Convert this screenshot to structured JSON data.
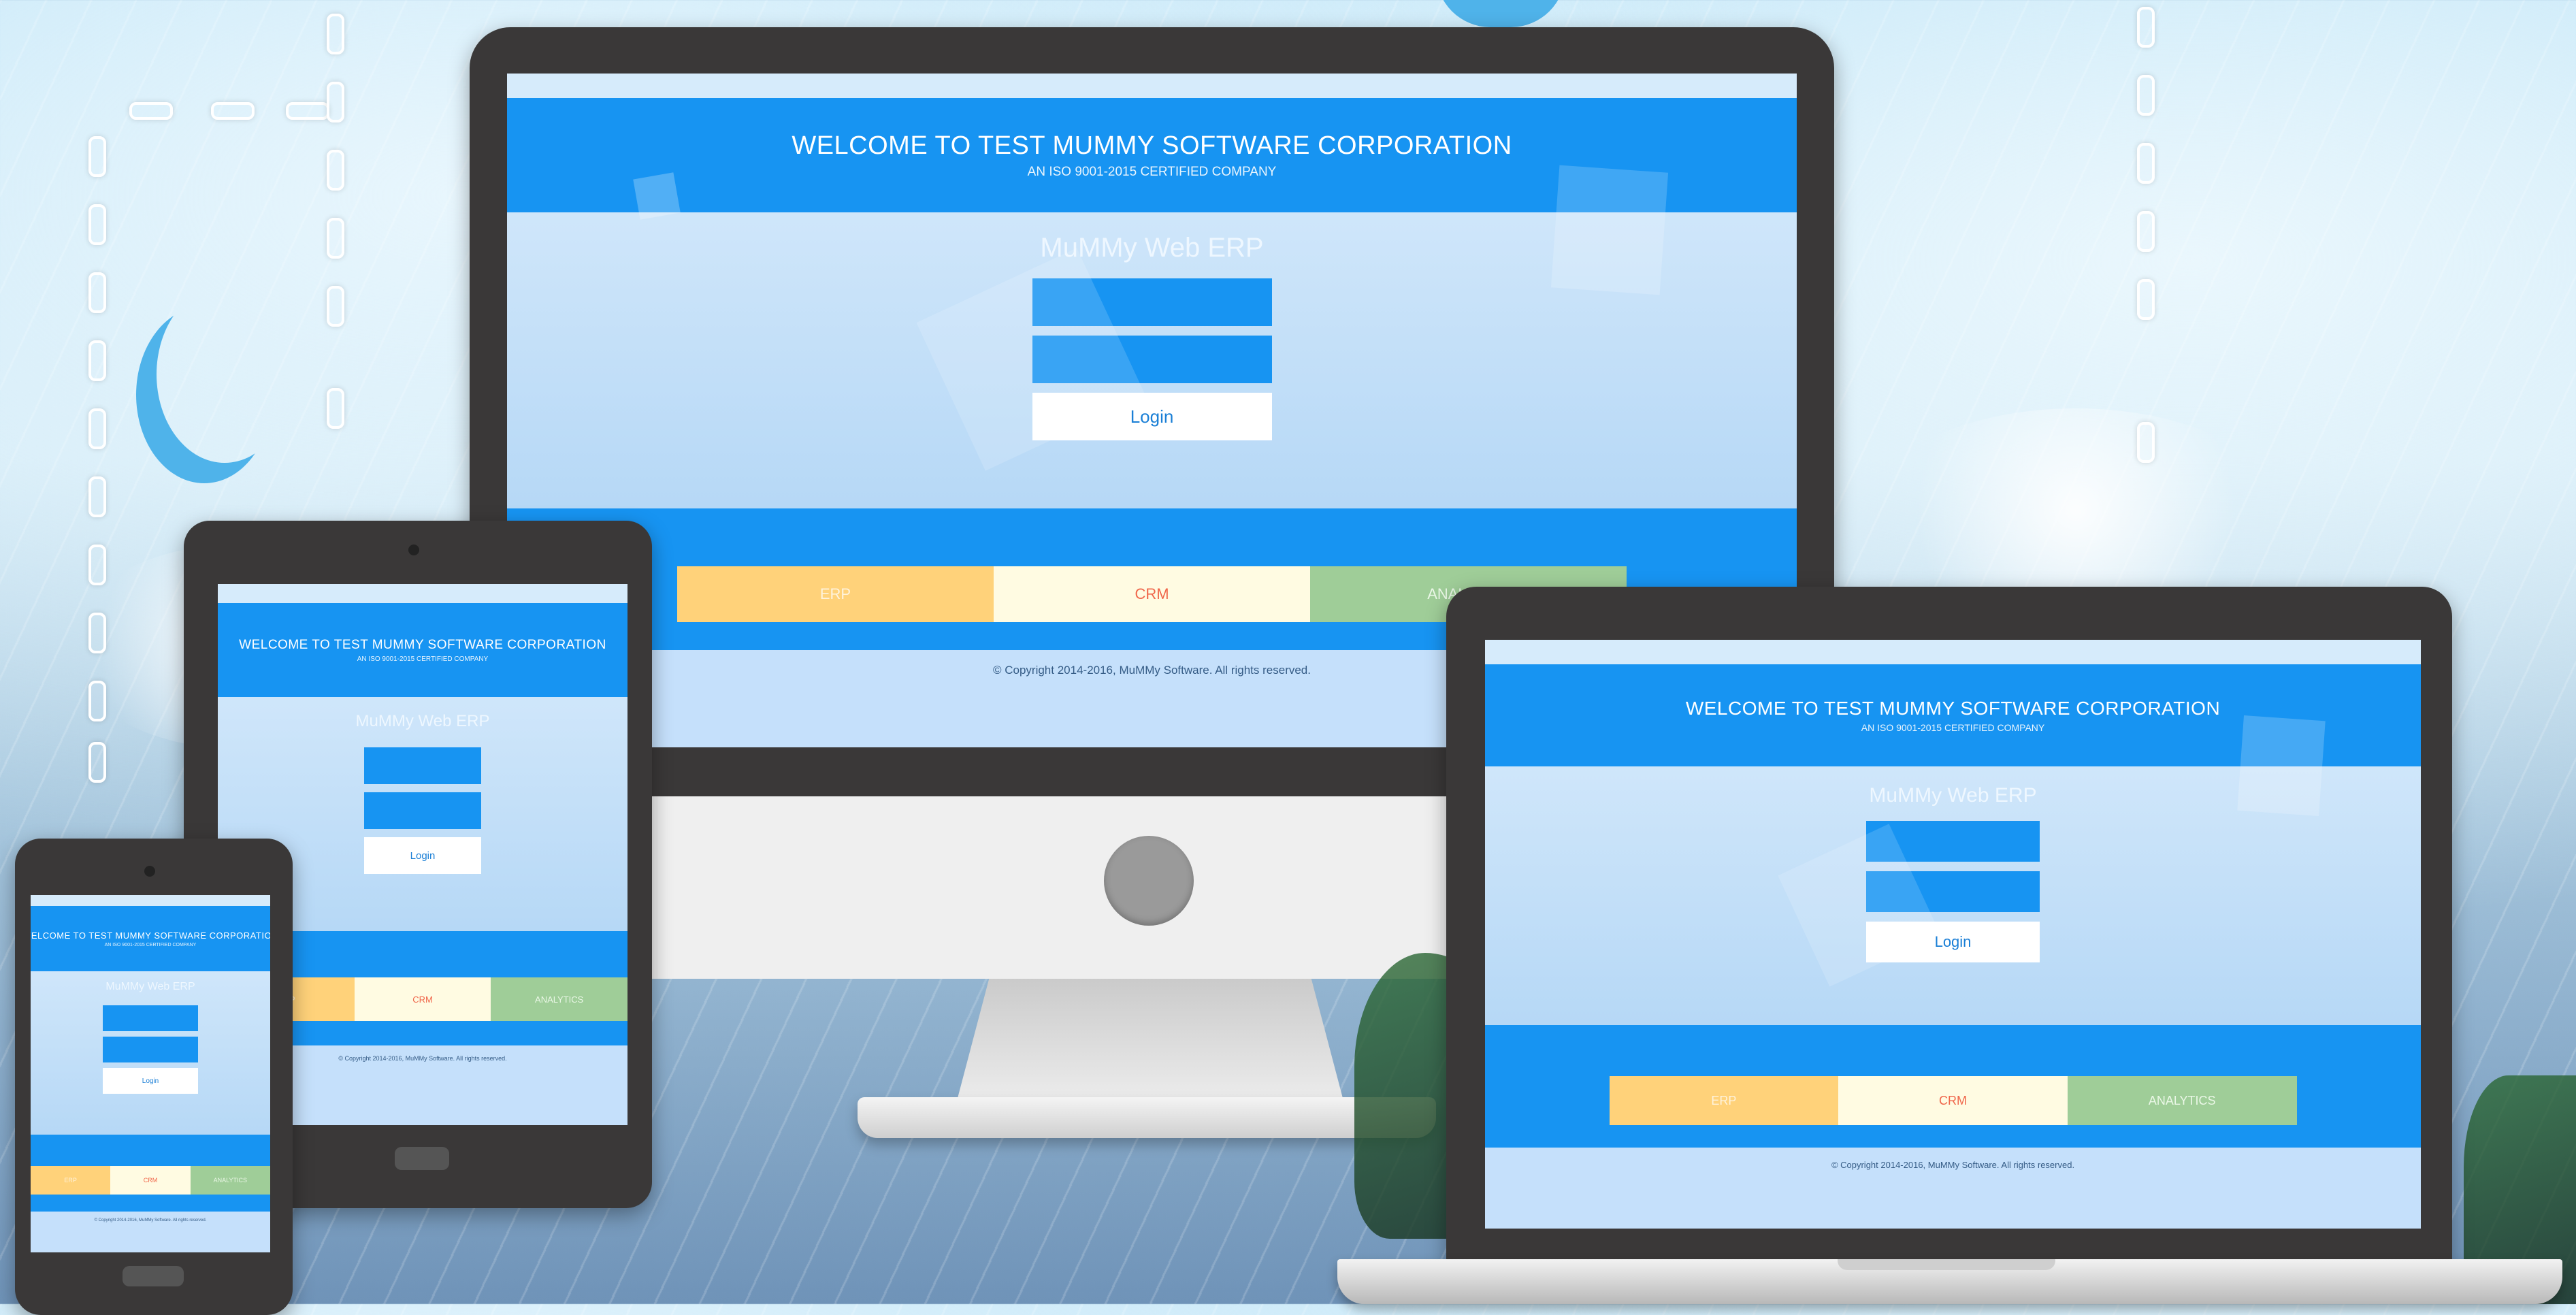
{
  "page": {
    "title": "WELCOME TO TEST MUMMY SOFTWARE CORPORATION",
    "subtitle": "AN ISO 9001-2015 CERTIFIED COMPANY",
    "app_title": "MuMMy Web ERP",
    "login_label": "Login",
    "modules": [
      "ERP",
      "CRM",
      "ANALYTICS"
    ],
    "footer": "© Copyright 2014-2016, MuMMy Software. All rights reserved."
  },
  "colors": {
    "header_blue": "#1794f2",
    "panel_light": "#c9e4fa",
    "erp_tile": "#ffd27a",
    "crm_tile": "#fffbe2",
    "crm_text": "#f0664a",
    "analytics_tile": "#9fcd98",
    "device_frame": "#3a3838"
  },
  "icons": {
    "monitor_logo": "apple-logo-circle",
    "tablet_camera": "camera-icon",
    "phone_home": "home-button-icon"
  }
}
